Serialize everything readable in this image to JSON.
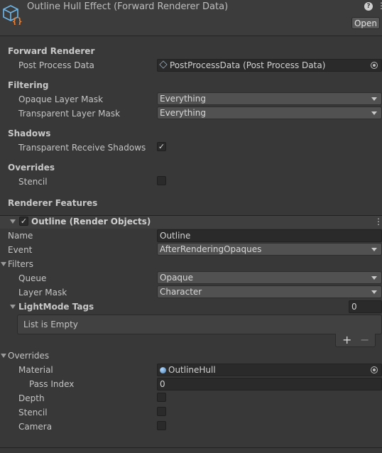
{
  "header": {
    "title": "Outline Hull Effect (Forward Renderer Data)",
    "help_glyph": "?",
    "open_label": "Open"
  },
  "forward_renderer": {
    "heading": "Forward Renderer",
    "post_process_label": "Post Process Data",
    "post_process_value": "PostProcessData (Post Process Data)"
  },
  "filtering": {
    "heading": "Filtering",
    "opaque_label": "Opaque Layer Mask",
    "opaque_value": "Everything",
    "transparent_label": "Transparent Layer Mask",
    "transparent_value": "Everything"
  },
  "shadows": {
    "heading": "Shadows",
    "receive_label": "Transparent Receive Shadows",
    "receive_checked": true
  },
  "overrides": {
    "heading": "Overrides",
    "stencil_label": "Stencil",
    "stencil_checked": false
  },
  "renderer_features": {
    "heading": "Renderer Features"
  },
  "feature": {
    "title": "Outline (Render Objects)",
    "enabled": true,
    "name_label": "Name",
    "name_value": "Outline",
    "event_label": "Event",
    "event_value": "AfterRenderingOpaques",
    "filters_heading": "Filters",
    "queue_label": "Queue",
    "queue_value": "Opaque",
    "layer_mask_label": "Layer Mask",
    "layer_mask_value": "Character",
    "lightmode_heading": "LightMode Tags",
    "lightmode_count": "0",
    "list_empty": "List is Empty",
    "plus": "+",
    "minus": "−",
    "overrides_heading": "Overrides",
    "material_label": "Material",
    "material_value": "OutlineHull",
    "pass_index_label": "Pass Index",
    "pass_index_value": "0",
    "depth_label": "Depth",
    "stencil_label": "Stencil",
    "camera_label": "Camera"
  }
}
